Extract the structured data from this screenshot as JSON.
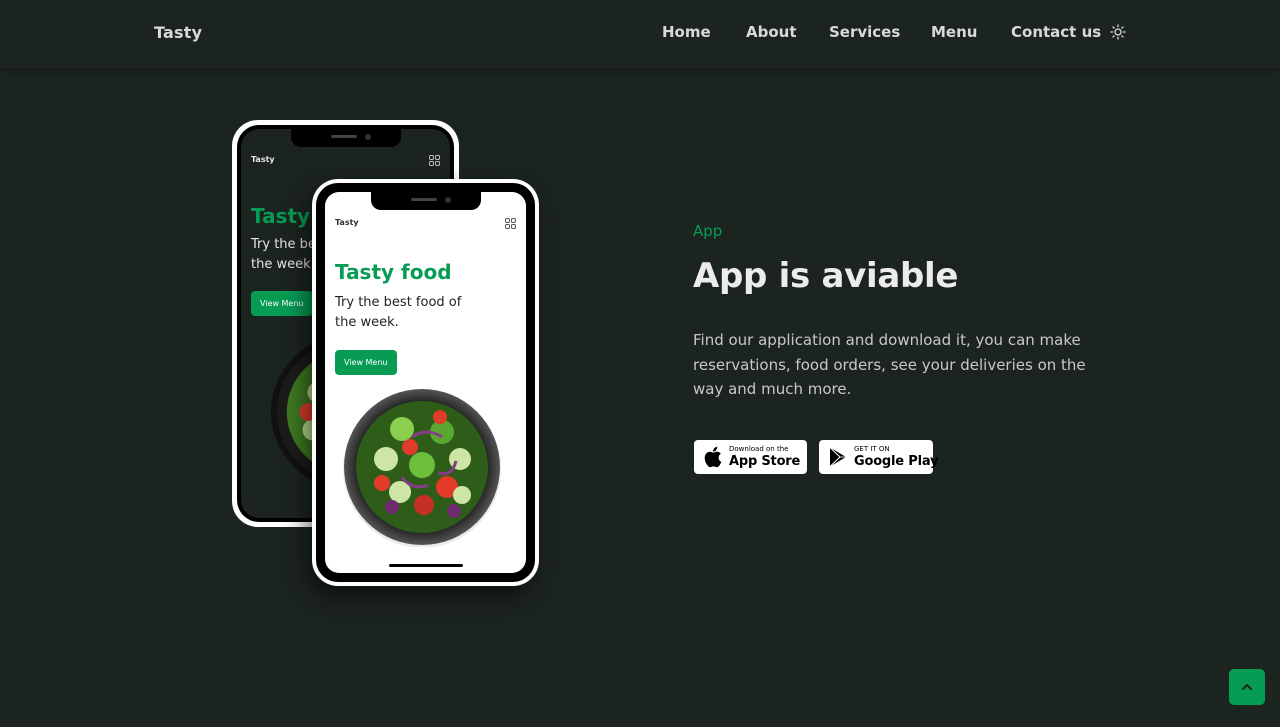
{
  "header": {
    "logo": "Tasty",
    "nav": [
      {
        "label": "Home"
      },
      {
        "label": "About"
      },
      {
        "label": "Services"
      },
      {
        "label": "Menu"
      },
      {
        "label": "Contact us"
      }
    ],
    "theme_icon": "sun-icon"
  },
  "phone_screen": {
    "logo": "Tasty",
    "title": "Tasty food",
    "text": "Try the best food of the week.",
    "button": "View Menu",
    "menu_icon": "grid-icon"
  },
  "app": {
    "subtitle": "App",
    "title": "App is aviable",
    "description": "Find our application and download it, you can make reservations, food orders, see your deliveries on the way and much more.",
    "app_store": {
      "small": "Download on the",
      "big": "App Store",
      "icon": "apple-icon"
    },
    "google_play": {
      "small": "GET IT ON",
      "big": "Google Play",
      "icon": "play-icon"
    }
  },
  "scroll_up_icon": "chevron-up-icon",
  "colors": {
    "background": "#1c2420",
    "accent": "#069c54",
    "text": "#ebebeb"
  }
}
